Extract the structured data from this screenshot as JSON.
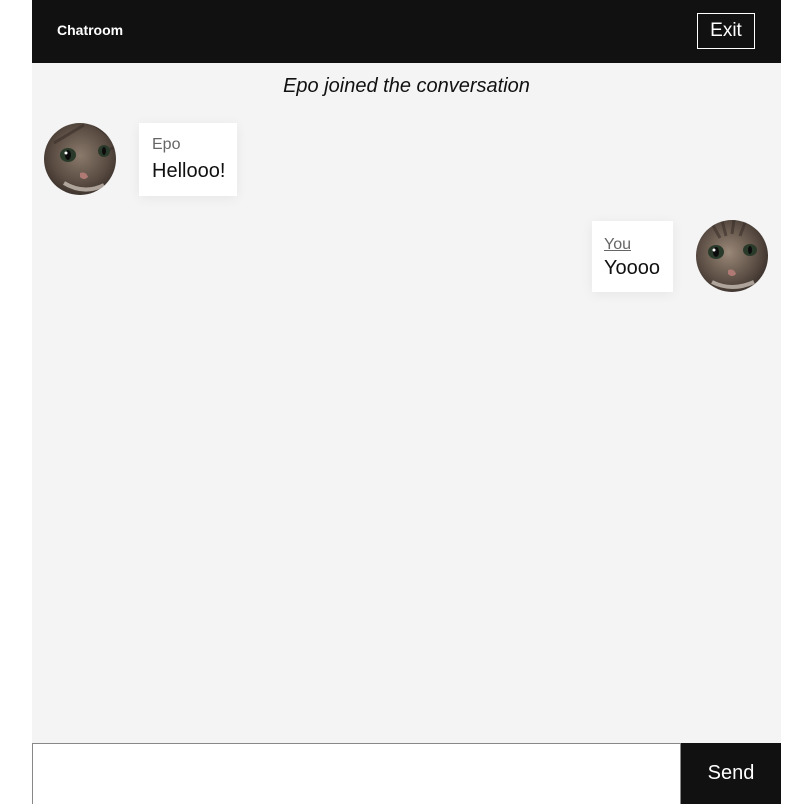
{
  "header": {
    "title": "Chatroom",
    "exit_label": "Exit"
  },
  "system_message": "Epo joined the conversation",
  "messages": [
    {
      "sender": "Epo",
      "text": "Hellooo!",
      "side": "left"
    },
    {
      "sender": "You",
      "text": "Yoooo",
      "side": "right"
    }
  ],
  "composer": {
    "placeholder": "",
    "value": "",
    "send_label": "Send"
  },
  "colors": {
    "header_bg": "#111111",
    "chat_bg": "#f4f4f4",
    "bubble_bg": "#ffffff",
    "sender_text": "#666666",
    "send_bg": "#111111"
  }
}
